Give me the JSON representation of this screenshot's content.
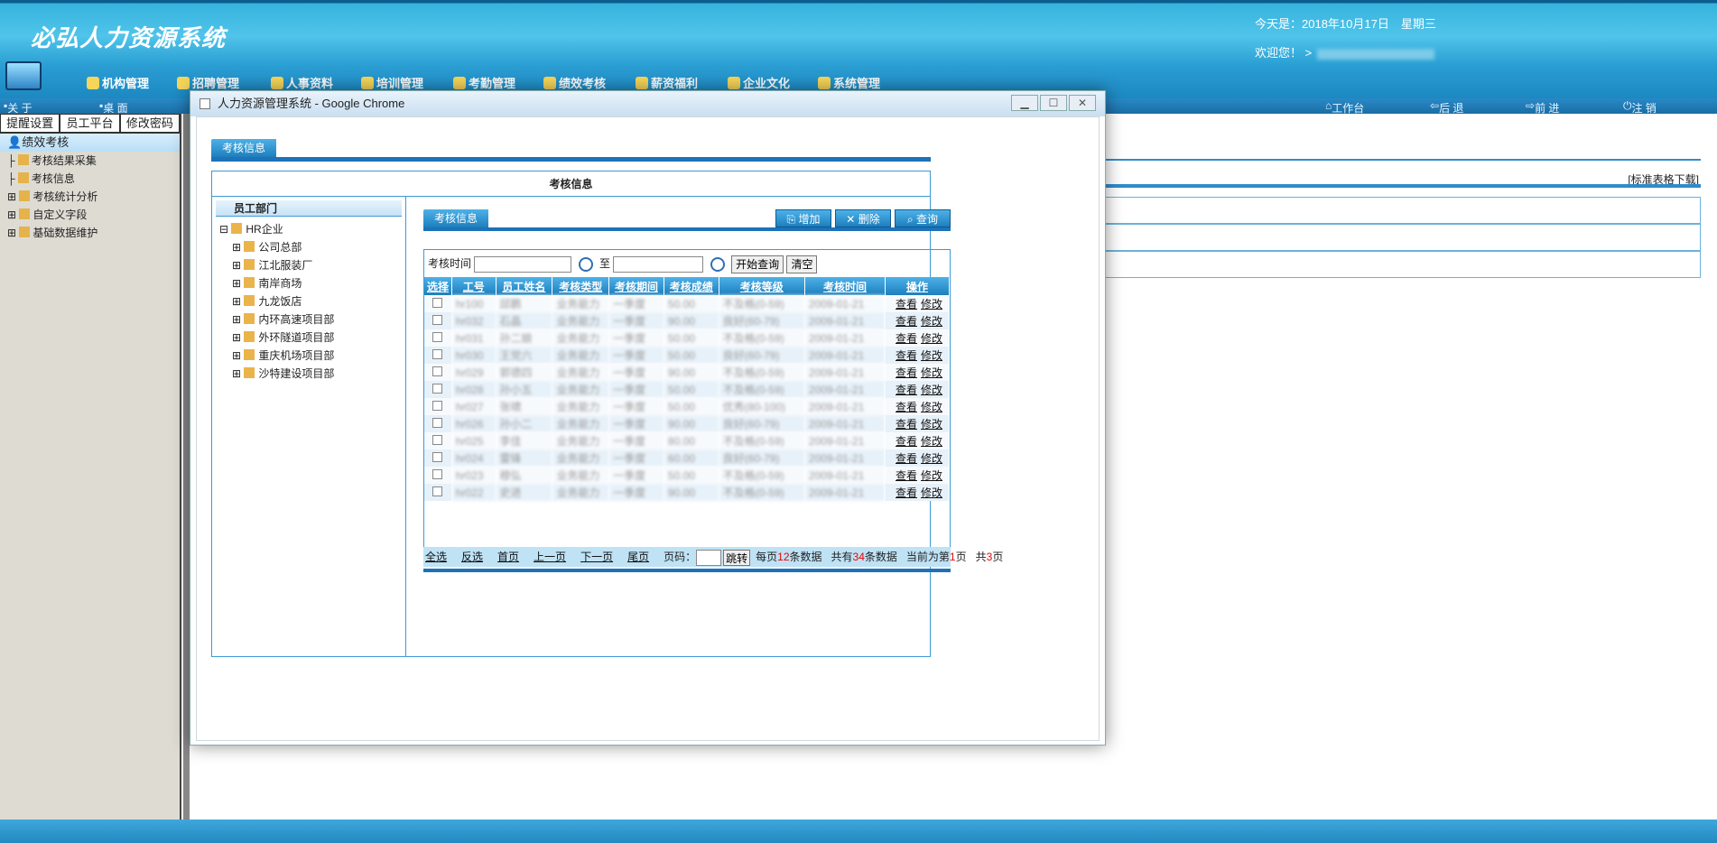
{
  "header": {
    "logo": "必弘人力资源系统",
    "today": "今天是：2018年10月17日　星期三",
    "welcome": "欢迎您！ >"
  },
  "nav": [
    {
      "label": "机构管理",
      "icon": "org-icon"
    },
    {
      "label": "招聘管理",
      "icon": "recruit-icon"
    },
    {
      "label": "人事资料",
      "icon": "personnel-icon"
    },
    {
      "label": "培训管理",
      "icon": "training-icon"
    },
    {
      "label": "考勤管理",
      "icon": "attendance-icon"
    },
    {
      "label": "绩效考核",
      "icon": "performance-icon"
    },
    {
      "label": "薪资福利",
      "icon": "salary-icon"
    },
    {
      "label": "企业文化",
      "icon": "culture-icon"
    },
    {
      "label": "系统管理",
      "icon": "system-icon"
    }
  ],
  "subnav": {
    "about": "关 于",
    "desktop": "桌 面",
    "workbench": "工作台",
    "back": "后 退",
    "forward": "前 进",
    "logout": "注 销"
  },
  "sidebar": {
    "tabs": [
      "提醒设置",
      "员工平台",
      "修改密码"
    ],
    "title": "绩效考核",
    "items": [
      "考核结果采集",
      "考核信息",
      "考核统计分析",
      "自定义字段",
      "基础数据维护"
    ]
  },
  "background": {
    "download_link": "[标准表格下载]"
  },
  "window": {
    "title": "人力资源管理系统 - Google Chrome",
    "tab_label": "考核信息",
    "panel_title": "考核信息",
    "dept_header": "员工部门",
    "dept_root": "HR企业",
    "depts": [
      "公司总部",
      "江北服装厂",
      "南岸商场",
      "九龙饭店",
      "内环高速项目部",
      "外环隧道项目部",
      "重庆机场项目部",
      "沙特建设项目部"
    ],
    "inner_tab": "考核信息",
    "buttons": {
      "add": "增加",
      "delete": "删除",
      "query": "查询"
    },
    "search": {
      "label": "考核时间",
      "to": "至",
      "start": "开始查询",
      "clear": "清空"
    },
    "columns": [
      "选择",
      "工号",
      "员工姓名",
      "考核类型",
      "考核期间",
      "考核成绩",
      "考核等级",
      "考核时间",
      "操作"
    ],
    "rows": [
      {
        "id": "hr100",
        "name": "邱鹏",
        "type": "业务能力",
        "period": "一季度",
        "score": "50.00",
        "grade": "不及格(0-59)",
        "date": "2009-01-21"
      },
      {
        "id": "hr032",
        "name": "石晶",
        "type": "业务能力",
        "period": "一季度",
        "score": "90.00",
        "grade": "良好(60-79)",
        "date": "2009-01-21"
      },
      {
        "id": "hr031",
        "name": "孙二娘",
        "type": "业务能力",
        "period": "一季度",
        "score": "50.00",
        "grade": "不及格(0-59)",
        "date": "2009-01-21"
      },
      {
        "id": "hr030",
        "name": "王党六",
        "type": "业务能力",
        "period": "一季度",
        "score": "50.00",
        "grade": "良好(60-79)",
        "date": "2009-01-21"
      },
      {
        "id": "hr029",
        "name": "郭德四",
        "type": "业务能力",
        "period": "一季度",
        "score": "90.00",
        "grade": "不及格(0-59)",
        "date": "2009-01-21"
      },
      {
        "id": "hr028",
        "name": "孙小五",
        "type": "业务能力",
        "period": "一季度",
        "score": "50.00",
        "grade": "不及格(0-59)",
        "date": "2009-01-21"
      },
      {
        "id": "hr027",
        "name": "张啸",
        "type": "业务能力",
        "period": "一季度",
        "score": "50.00",
        "grade": "优秀(80-100)",
        "date": "2009-01-21"
      },
      {
        "id": "hr026",
        "name": "孙小二",
        "type": "业务能力",
        "period": "一季度",
        "score": "90.00",
        "grade": "良好(60-79)",
        "date": "2009-01-21"
      },
      {
        "id": "hr025",
        "name": "李佳",
        "type": "业务能力",
        "period": "一季度",
        "score": "80.00",
        "grade": "不及格(0-59)",
        "date": "2009-01-21"
      },
      {
        "id": "hr024",
        "name": "雷锋",
        "type": "业务能力",
        "period": "一季度",
        "score": "60.00",
        "grade": "良好(60-79)",
        "date": "2009-01-21"
      },
      {
        "id": "hr023",
        "name": "穆弘",
        "type": "业务能力",
        "period": "一季度",
        "score": "50.00",
        "grade": "不及格(0-59)",
        "date": "2009-01-21"
      },
      {
        "id": "hr022",
        "name": "史进",
        "type": "业务能力",
        "period": "一季度",
        "score": "90.00",
        "grade": "不及格(0-59)",
        "date": "2009-01-21"
      }
    ],
    "ops": {
      "view": "查看",
      "edit": "修改"
    },
    "pager": {
      "select_all": "全选",
      "invert": "反选",
      "first": "首页",
      "prev": "上一页",
      "next": "下一页",
      "last": "尾页",
      "page_label": "页码：",
      "jump": "跳转",
      "per_page_pre": "每页",
      "per_page": "12",
      "per_page_post": "条数据",
      "total_pre": "共有",
      "total": "34",
      "total_post": "条数据",
      "current_pre": "当前为第",
      "current": "1",
      "current_post": "页",
      "pages_pre": "共",
      "pages": "3",
      "pages_post": "页"
    }
  }
}
